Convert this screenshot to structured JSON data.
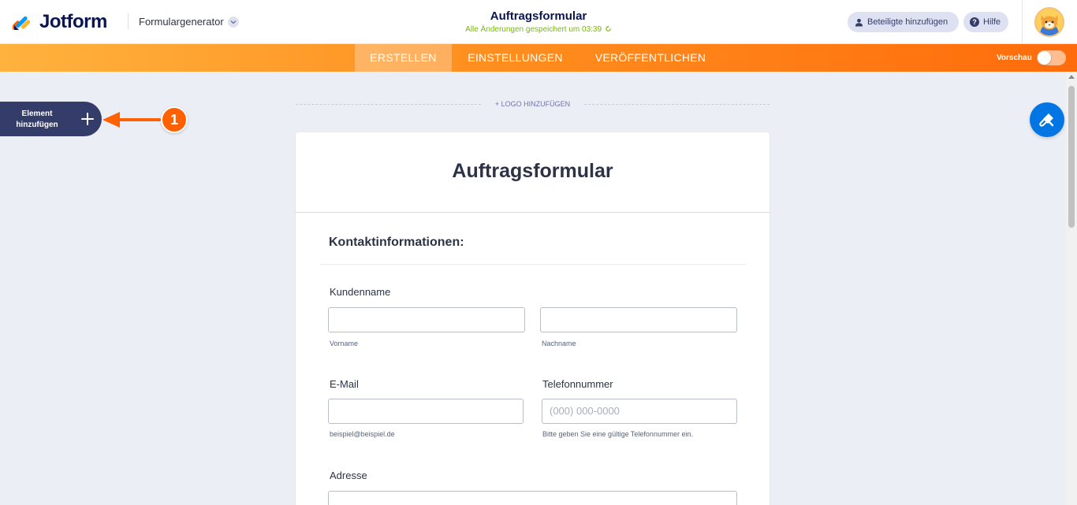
{
  "header": {
    "logo_text": "Jotform",
    "app_switcher_label": "Formulargenerator",
    "form_title": "Auftragsformular",
    "save_status": "Alle Änderungen gespeichert um 03:39",
    "invite_label": "Beteiligte hinzufügen",
    "help_label": "Hilfe",
    "icons": [
      "user-icon",
      "help-icon",
      "chevron-down-icon",
      "refresh-icon"
    ]
  },
  "navbar": {
    "tabs": [
      {
        "label": "ERSTELLEN",
        "active": true
      },
      {
        "label": "EINSTELLUNGEN",
        "active": false
      },
      {
        "label": "VERÖFFENTLICHEN",
        "active": false
      }
    ],
    "preview_label": "Vorschau",
    "preview_enabled": false
  },
  "sidebar": {
    "add_element_label": "Element hinzufügen",
    "annotation_number": "1"
  },
  "canvas": {
    "add_logo_label": "+ LOGO HINZUFÜGEN"
  },
  "form": {
    "title": "Auftragsformular",
    "section_title": "Kontaktinformationen:",
    "customer_name_label": "Kundenname",
    "first_name_sublabel": "Vorname",
    "last_name_sublabel": "Nachname",
    "email_label": "E-Mail",
    "email_sublabel": "beispiel@beispiel.de",
    "phone_label": "Telefonnummer",
    "phone_placeholder": "(000) 000-0000",
    "phone_sublabel": "Bitte geben Sie eine gültige Telefonnummer ein.",
    "address_label": "Adresse"
  },
  "colors": {
    "brand_navy": "#0a1551",
    "accent_orange": "#ff6100",
    "save_green": "#78bb07",
    "designer_blue": "#0075e3"
  }
}
